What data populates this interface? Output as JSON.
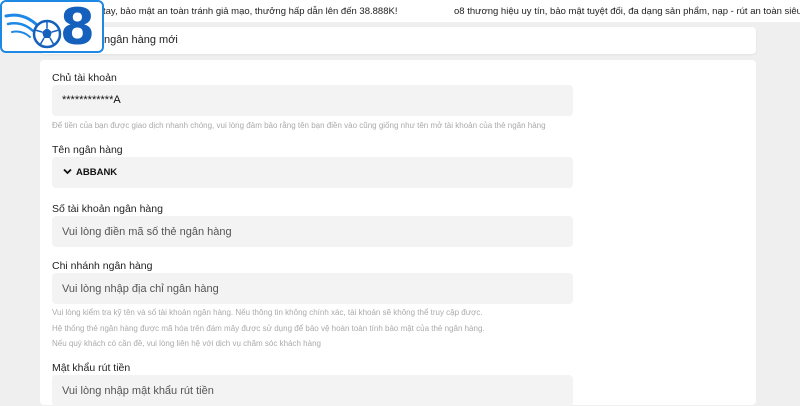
{
  "marquee": {
    "text1": "tay, bảo mật an toàn tránh giả mạo, thưởng hấp dẫn lên đến 38.888K!",
    "text2": "o8 thương hiệu uy tín, bảo mật tuyệt đối, đa dạng sản phẩm, nạp - rút an toàn siêu tốc"
  },
  "logo": {
    "digit": "8",
    "icon": "soccer-ball-icon",
    "brand_color": "#1560bd"
  },
  "header": {
    "title": "ngân hàng mới"
  },
  "form": {
    "account_holder": {
      "label": "Chủ tài khoản",
      "value": "************A",
      "hint": "Để tiền của bạn được giao dịch nhanh chóng, vui lòng đảm bảo rằng tên bạn điền vào cũng giống như tên mở tài khoản của thẻ ngân hàng"
    },
    "bank_name": {
      "label": "Tên ngân hàng",
      "value": "ABBANK",
      "icon": "chevron-down-icon"
    },
    "account_number": {
      "label": "Số tài khoản ngân hàng",
      "placeholder": "Vui lòng điền mã số thẻ ngân hàng"
    },
    "branch": {
      "label": "Chi nhánh ngân hàng",
      "placeholder": "Vui lòng nhập địa chỉ ngân hàng",
      "hint_lines": [
        "Vui lòng kiểm tra kỹ tên và số tài khoản ngân hàng. Nếu thông tin không chính xác, tài khoản sẽ không thể truy cập được.",
        "Hệ thống thẻ ngân hàng được mã hóa trên đám mây được sử dụng để bảo vệ hoàn toàn tính bảo mật của thẻ ngân hàng.",
        "Nếu quý khách có cần đề, vui lòng liên hệ với dịch vụ chăm sóc khách hàng"
      ]
    },
    "withdraw_password": {
      "label": "Mật khẩu rút tiền",
      "placeholder": "Vui lòng nhập mật khẩu rút tiền"
    }
  }
}
